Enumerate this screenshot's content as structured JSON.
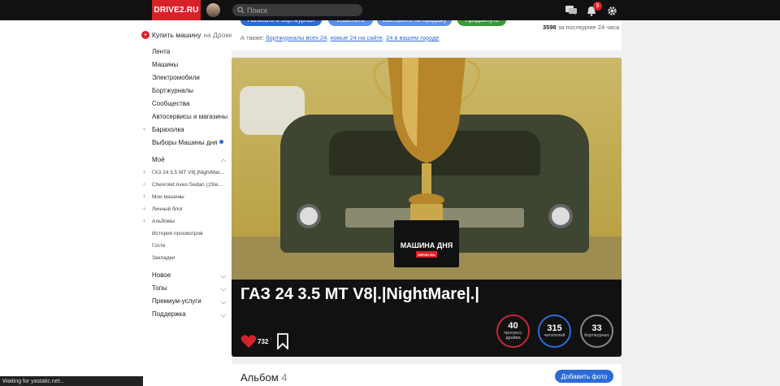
{
  "header": {
    "logo": "DRIVE2.RU",
    "search_placeholder": "Поиск",
    "notifications_count": "9"
  },
  "sidebar": {
    "buy_car": {
      "label": "Купить машину",
      "suffix": "на Дроме"
    },
    "main_items": [
      "Лента",
      "Машины",
      "Электромобили",
      "Бортжурналы",
      "Сообщества",
      "Автосервисы и магазины",
      "Барахолка",
      "Выборы Машины дня"
    ],
    "my_section": "Моё",
    "my_items": [
      "ГАЗ 24 3.5 MT V8|.|NightMar...",
      "Chevrolet Aveo Sedan |.|Ste...",
      "Мои машины",
      "Личный блог",
      "Альбомы",
      "История просмотров",
      "Гости",
      "Закладки"
    ],
    "bottom_sections": [
      "Новое",
      "Топы",
      "Премиум-услуги",
      "Поддержка"
    ]
  },
  "top_card": {
    "buttons": [
      "Написать в бортжурнал",
      "Изменить",
      "Выставить на продажу",
      "Продвинуть"
    ],
    "also_prefix": "А также:",
    "also_links": [
      "бортжурналы всех 24",
      "новые 24 на сайте",
      "24 в вашем городе"
    ],
    "stats_value": "3598",
    "stats_label": "за последние 24 часа"
  },
  "hero": {
    "badge_title": "МАШИНА ДНЯ",
    "badge_logo": "DRIVE2.RU",
    "car_title": "ГАЗ 24 3.5 MT V8|.|NightMare|.|",
    "likes": "732",
    "stats": [
      {
        "value": "40",
        "label": "прогресс драйва",
        "color": "#c8253c"
      },
      {
        "value": "315",
        "label": "читателей",
        "color": "#2a6bd8"
      },
      {
        "value": "33",
        "label": "бортжурнал",
        "color": "#888888"
      }
    ]
  },
  "album": {
    "title": "Альбом",
    "count": "4",
    "add_button": "Добавить фото"
  },
  "status_bar": "Waiting for yastatic.net..."
}
